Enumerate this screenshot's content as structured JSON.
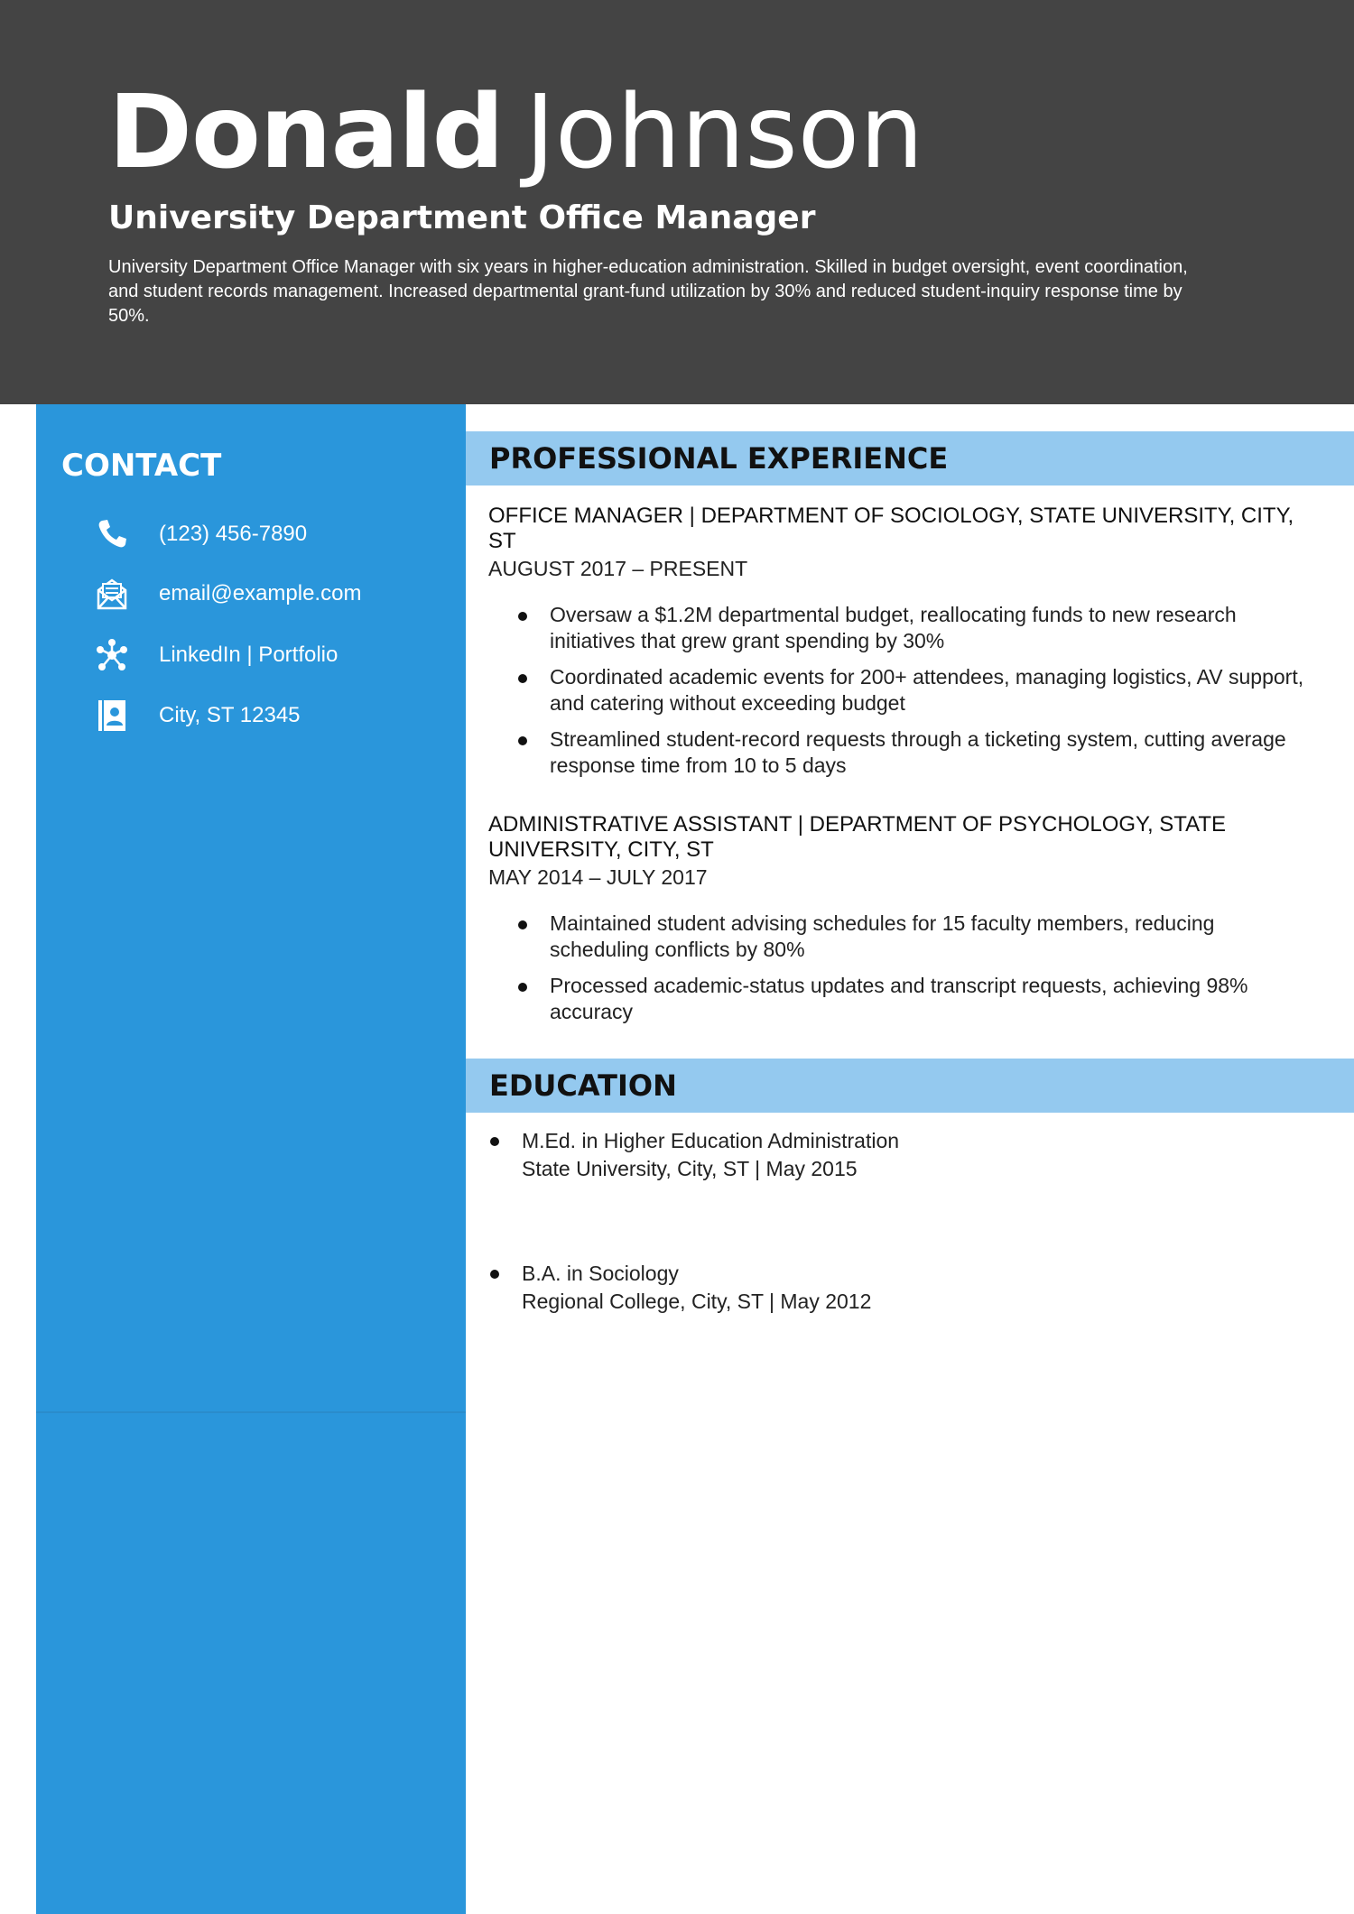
{
  "header": {
    "first_name": "Donald",
    "last_name": "Johnson",
    "title": "University Department Office Manager",
    "summary": "University Department Office Manager with six years in higher-education administration. Skilled in budget oversight, event coordination, and student records management. Increased departmental grant-fund utilization by 30% and reduced student-inquiry response time by 50%."
  },
  "contact": {
    "heading": "CONTACT",
    "items": [
      {
        "icon": "phone-icon",
        "text": "(123) 456-7890"
      },
      {
        "icon": "email-icon",
        "text": "email@example.com"
      },
      {
        "icon": "network-icon",
        "text": "LinkedIn | Portfolio"
      },
      {
        "icon": "address-card-icon",
        "text": "City, ST 12345"
      }
    ]
  },
  "experience": {
    "heading": "PROFESSIONAL EXPERIENCE",
    "jobs": [
      {
        "title": "OFFICE MANAGER | DEPARTMENT OF SOCIOLOGY, STATE UNIVERSITY, CITY, ST",
        "dates": "AUGUST 2017 – PRESENT",
        "bullets": [
          "Oversaw a $1.2M departmental budget, reallocating funds to new research initiatives that grew grant spending by 30%",
          "Coordinated academic events for 200+ attendees, managing logistics, AV support, and catering without exceeding budget",
          "Streamlined student-record requests through a ticketing system, cutting average response time from 10 to 5 days"
        ]
      },
      {
        "title": "ADMINISTRATIVE ASSISTANT | DEPARTMENT OF PSYCHOLOGY, STATE UNIVERSITY, CITY, ST",
        "dates": "MAY 2014 – JULY 2017",
        "bullets": [
          "Maintained student advising schedules for 15 faculty members, reducing scheduling conflicts by 80%",
          "Processed academic-status updates and transcript requests, achieving 98% accuracy"
        ]
      }
    ]
  },
  "education": {
    "heading": "EDUCATION",
    "items": [
      {
        "degree": "M.Ed. in Higher Education Administration",
        "school": "State University, City, ST | May 2015"
      },
      {
        "degree": "B.A. in Sociology",
        "school": "Regional College, City, ST | May 2012"
      }
    ]
  },
  "colors": {
    "header_bg": "#444444",
    "sidebar_bg": "#2a96db",
    "section_bar_bg": "#94c9ef"
  }
}
